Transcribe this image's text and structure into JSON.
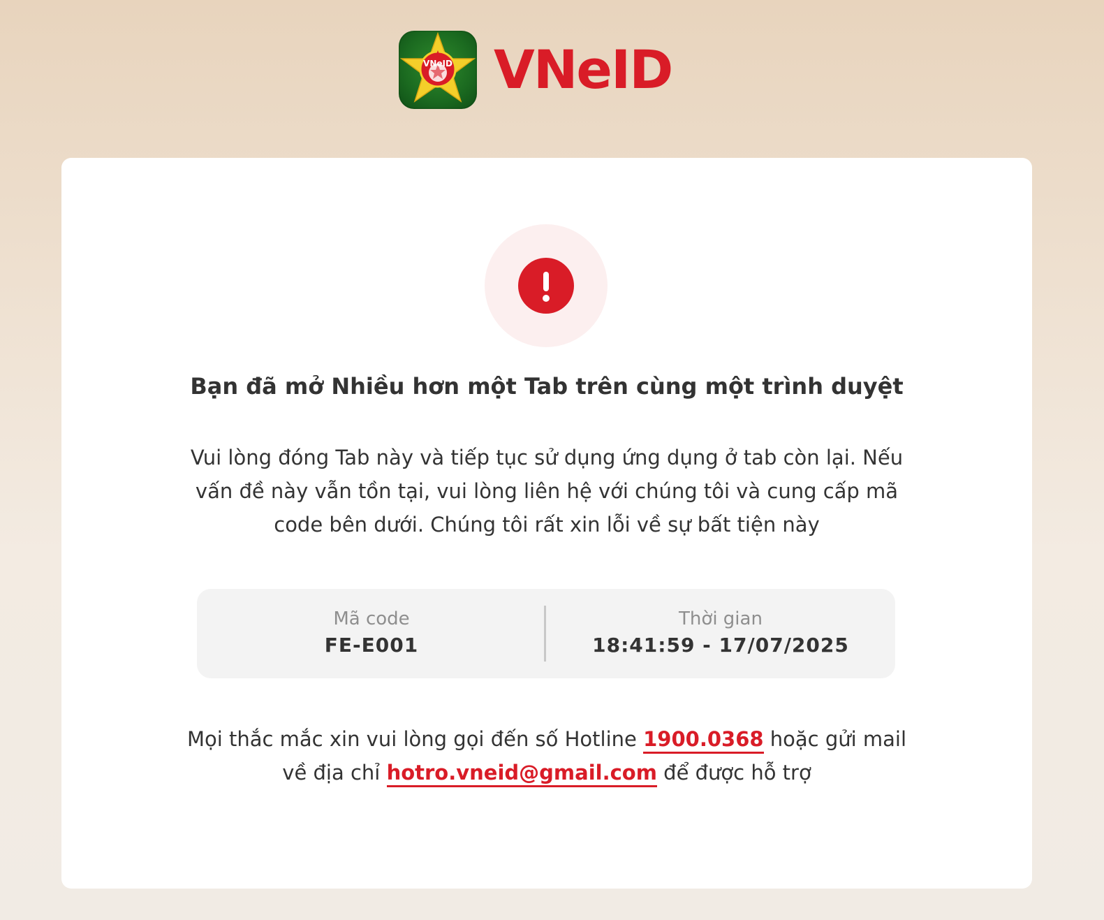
{
  "brand": {
    "name": "VNeID",
    "badge_text": "VNeID",
    "accent_color": "#d91c27",
    "badge_color": "#1b6a20"
  },
  "alert": {
    "icon": "exclamation-icon",
    "icon_glyph": "!"
  },
  "message": {
    "title": "Bạn đã mở Nhiều hơn một Tab trên cùng một trình duyệt",
    "description": "Vui lòng đóng Tab này và tiếp tục sử dụng ứng dụng ở tab còn lại. Nếu vấn đề này vẫn tồn tại, vui lòng liên hệ với chúng tôi và cung cấp mã code bên dưới. Chúng tôi rất xin lỗi về sự bất tiện này"
  },
  "info": {
    "code_label": "Mã code",
    "code_value": "FE-E001",
    "time_label": "Thời gian",
    "time_value": "18:41:59 - 17/07/2025"
  },
  "support": {
    "text_before_hotline": "Mọi thắc mắc xin vui lòng gọi đến số Hotline ",
    "hotline": "1900.0368",
    "text_before_email": " hoặc gửi mail về địa chỉ ",
    "email": "hotro.vneid@gmail.com",
    "text_after_email": " để được hỗ trợ"
  }
}
